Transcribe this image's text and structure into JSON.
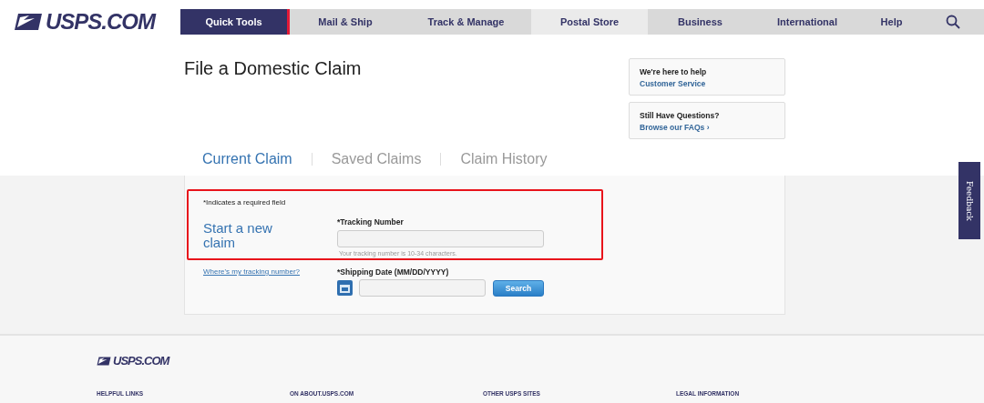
{
  "logo": "USPS.COM",
  "nav": [
    {
      "label": "Quick Tools",
      "selected": true
    },
    {
      "label": "Mail & Ship",
      "selected": false
    },
    {
      "label": "Track & Manage",
      "selected": false
    },
    {
      "label": "Postal Store",
      "selected": false
    },
    {
      "label": "Business",
      "selected": false
    },
    {
      "label": "International",
      "selected": false
    },
    {
      "label": "Help",
      "selected": false
    }
  ],
  "title": "File a Domestic Claim",
  "help_cards": [
    {
      "heading": "We're here to help",
      "link": "Customer Service"
    },
    {
      "heading": "Still Have Questions?",
      "link": "Browse our FAQs ›"
    }
  ],
  "tabs": [
    {
      "label": "Current Claim",
      "selected": true
    },
    {
      "label": "Saved Claims",
      "selected": false
    },
    {
      "label": "Claim History",
      "selected": false
    }
  ],
  "form": {
    "required_note": "*Indicates a required field",
    "heading": "Start a new claim",
    "help_link": "Where's my tracking number?",
    "tracking": {
      "label": "*Tracking Number",
      "hint": "Your tracking number is 10-34 characters."
    },
    "date": {
      "label": "*Shipping Date (MM/DD/YYYY)"
    },
    "button": "Search"
  },
  "feedback": "Feedback",
  "footer": {
    "logo": "USPS.COM",
    "columns": [
      "HELPFUL LINKS",
      "ON ABOUT.USPS.COM",
      "OTHER USPS SITES",
      "LEGAL INFORMATION"
    ]
  }
}
